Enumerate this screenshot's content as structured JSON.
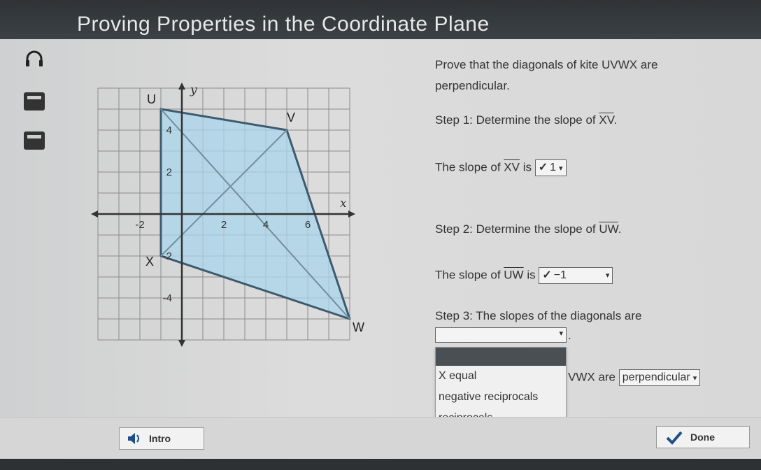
{
  "page": {
    "title": "Proving Properties in the Coordinate Plane"
  },
  "graph": {
    "y_axis_label": "y",
    "x_axis_label": "x",
    "x_ticks": [
      "-2",
      "2",
      "4",
      "6"
    ],
    "y_ticks": [
      "4",
      "2",
      "-2",
      "-4"
    ],
    "vertices": [
      {
        "name": "U",
        "x": -1,
        "y": 5
      },
      {
        "name": "V",
        "x": 5,
        "y": 4
      },
      {
        "name": "W",
        "x": 8,
        "y": -5
      },
      {
        "name": "X",
        "x": -1,
        "y": -2
      }
    ],
    "x_range": [
      -4,
      8
    ],
    "y_range": [
      -6,
      6
    ],
    "fill_color": "#a9d6ec",
    "edge_color": "#3e5a6e",
    "grid": true
  },
  "problem": {
    "prompt": "Prove that the diagonals of kite UVWX are perpendicular.",
    "step1_prefix": "Step 1: Determine the slope of ",
    "step1_segment": "XV",
    "step1_suffix": ".",
    "slope1_prefix": "The slope of ",
    "slope1_segment": "XV",
    "slope1_mid": " is ",
    "slope1_check": "✓",
    "slope1_answer": "1",
    "step2_prefix": "Step 2: Determine the slope of ",
    "step2_segment": "UW",
    "step2_suffix": ".",
    "slope2_prefix": "The slope of ",
    "slope2_segment": "UW",
    "slope2_mid": " is ",
    "slope2_check": "✓",
    "slope2_answer": "−1",
    "step3_text": "Step 3: The slopes of the diagonals are",
    "step3_period": ".",
    "conclusion_fragment": "VWX are",
    "conclusion_answer": "perpendicular",
    "dropdown_options": [
      "equal",
      "negative reciprocals",
      "reciprocals"
    ],
    "hover_mark": "X"
  },
  "footer": {
    "intro_label": "Intro",
    "done_label": "Done"
  }
}
